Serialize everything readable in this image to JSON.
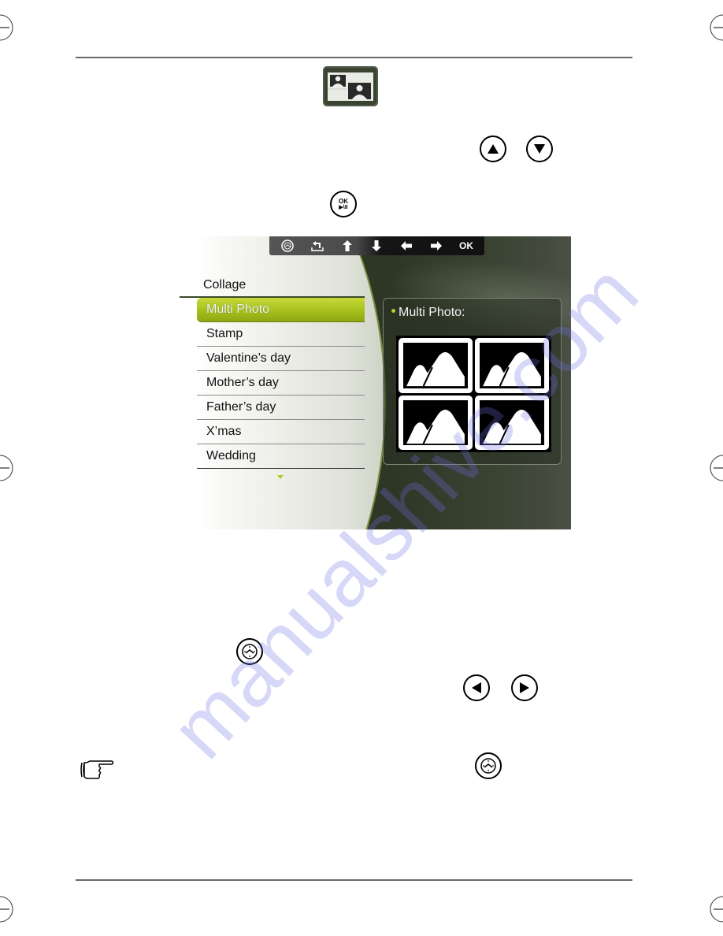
{
  "page": {
    "top_rule": true,
    "bottom_rule": true
  },
  "icons": {
    "collage_app_icon": "collage-app-icon",
    "up_button": "up-arrow-button-icon",
    "down_button": "down-arrow-button-icon",
    "ok_play_pause_button": {
      "line1": "OK",
      "line2": "▶\\II"
    },
    "menu_button_1": "menu-button-icon",
    "left_button": "left-arrow-button-icon",
    "right_button": "right-arrow-button-icon",
    "note_hand": "pointing-hand-icon",
    "menu_button_2": "menu-button-icon"
  },
  "screen": {
    "toolbar": {
      "items": [
        {
          "name": "menu",
          "icon": "menu-dial-icon"
        },
        {
          "name": "back",
          "icon": "return-icon"
        },
        {
          "name": "up",
          "icon": "arrow-up-icon"
        },
        {
          "name": "down",
          "icon": "arrow-down-icon"
        },
        {
          "name": "left",
          "icon": "arrow-left-icon"
        },
        {
          "name": "right",
          "icon": "arrow-right-icon"
        },
        {
          "name": "ok",
          "label": "OK"
        }
      ]
    },
    "menu_title": "Collage",
    "menu_items": [
      {
        "label": "Multi Photo",
        "selected": true
      },
      {
        "label": "Stamp",
        "selected": false
      },
      {
        "label": "Valentine’s day",
        "selected": false
      },
      {
        "label": "Mother’s day",
        "selected": false
      },
      {
        "label": "Father’s day",
        "selected": false
      },
      {
        "label": "X’mas",
        "selected": false
      },
      {
        "label": "Wedding",
        "selected": false
      }
    ],
    "more_indicator": "scroll-down-arrow",
    "preview": {
      "label": "Multi Photo:",
      "cells": 4
    },
    "colors": {
      "selected_item": "#a9c21e",
      "bullet": "#b8d033",
      "background_dark": "#2e3726"
    }
  },
  "watermark": "manualshive.com"
}
